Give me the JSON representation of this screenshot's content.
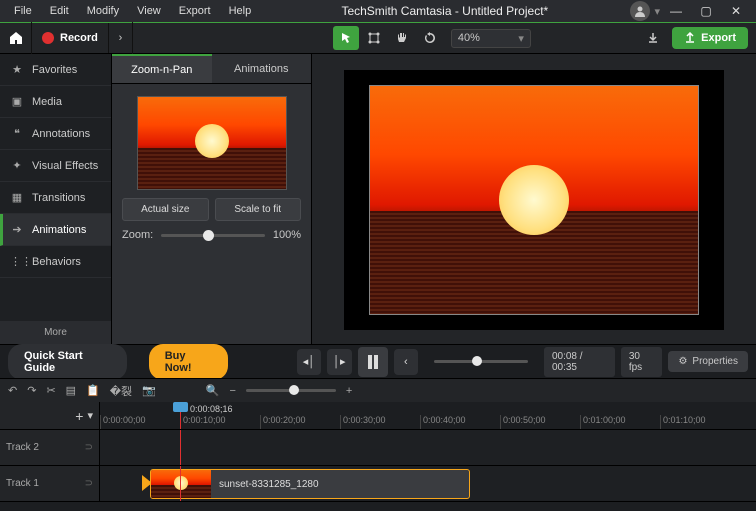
{
  "menu": {
    "items": [
      "File",
      "Edit",
      "Modify",
      "View",
      "Export",
      "Help"
    ],
    "title": "TechSmith Camtasia - Untitled Project*"
  },
  "toolbar": {
    "record": "Record",
    "zoom_value": "40%",
    "export": "Export"
  },
  "sidebar": {
    "items": [
      {
        "icon": "★",
        "label": "Favorites"
      },
      {
        "icon": "▣",
        "label": "Media"
      },
      {
        "icon": "❝",
        "label": "Annotations"
      },
      {
        "icon": "✦",
        "label": "Visual Effects"
      },
      {
        "icon": "▦",
        "label": "Transitions"
      },
      {
        "icon": "➔",
        "label": "Animations"
      },
      {
        "icon": "⋮⋮",
        "label": "Behaviors"
      }
    ],
    "more": "More"
  },
  "panel": {
    "tabs": [
      "Zoom-n-Pan",
      "Animations"
    ],
    "actual_size": "Actual size",
    "scale_fit": "Scale to fit",
    "zoom_label": "Zoom:",
    "zoom_value": "100%"
  },
  "playbar": {
    "quick_start": "Quick Start Guide",
    "buy": "Buy Now!",
    "timecode": "00:08 / 00:35",
    "fps": "30 fps",
    "properties": "Properties"
  },
  "timeline": {
    "playhead": "0:00:08;16",
    "ticks": [
      "0:00:00;00",
      "0:00:10;00",
      "0:00:20;00",
      "0:00:30;00",
      "0:00:40;00",
      "0:00:50;00",
      "0:01:00;00",
      "0:01:10;00"
    ],
    "tracks": [
      "Track 2",
      "Track 1"
    ],
    "clip_name": "sunset-8331285_1280"
  }
}
